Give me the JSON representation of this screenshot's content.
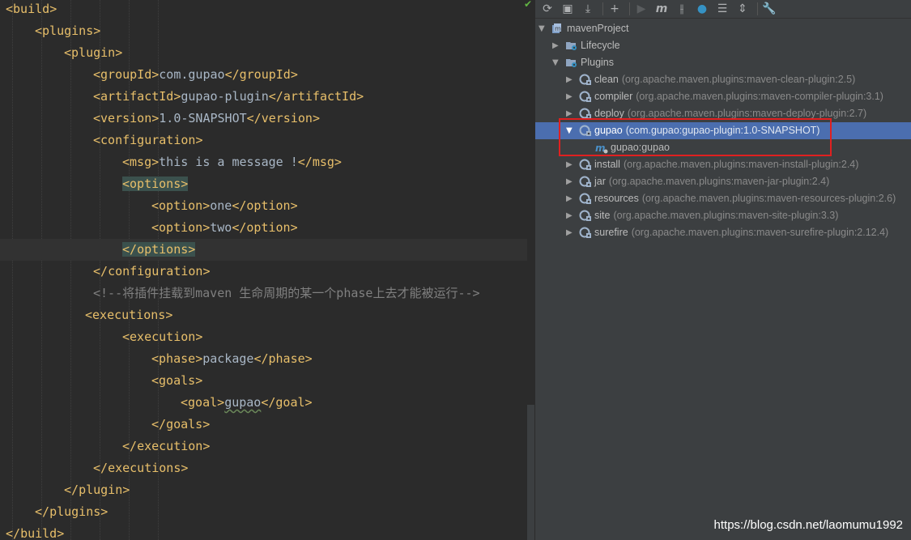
{
  "editor": {
    "lines": [
      {
        "indent": 0,
        "parts": [
          {
            "c": "lt",
            "t": "<"
          },
          {
            "c": "tg",
            "t": "build"
          },
          {
            "c": "lt",
            "t": ">"
          }
        ]
      },
      {
        "indent": 1,
        "parts": [
          {
            "c": "lt",
            "t": "<"
          },
          {
            "c": "tg",
            "t": "plugins"
          },
          {
            "c": "lt",
            "t": ">"
          }
        ]
      },
      {
        "indent": 2,
        "parts": [
          {
            "c": "lt",
            "t": "<"
          },
          {
            "c": "tg",
            "t": "plugin"
          },
          {
            "c": "lt",
            "t": ">"
          }
        ]
      },
      {
        "indent": 3,
        "parts": [
          {
            "c": "lt",
            "t": "<"
          },
          {
            "c": "tg",
            "t": "groupId"
          },
          {
            "c": "lt",
            "t": ">"
          },
          {
            "c": "tx",
            "t": "com.gupao"
          },
          {
            "c": "lt",
            "t": "</"
          },
          {
            "c": "tg",
            "t": "groupId"
          },
          {
            "c": "lt",
            "t": ">"
          }
        ]
      },
      {
        "indent": 3,
        "parts": [
          {
            "c": "lt",
            "t": "<"
          },
          {
            "c": "tg",
            "t": "artifactId"
          },
          {
            "c": "lt",
            "t": ">"
          },
          {
            "c": "tx",
            "t": "gupao-plugin"
          },
          {
            "c": "lt",
            "t": "</"
          },
          {
            "c": "tg",
            "t": "artifactId"
          },
          {
            "c": "lt",
            "t": ">"
          }
        ]
      },
      {
        "indent": 3,
        "parts": [
          {
            "c": "lt",
            "t": "<"
          },
          {
            "c": "tg",
            "t": "version"
          },
          {
            "c": "lt",
            "t": ">"
          },
          {
            "c": "tx",
            "t": "1.0-SNAPSHOT"
          },
          {
            "c": "lt",
            "t": "</"
          },
          {
            "c": "tg",
            "t": "version"
          },
          {
            "c": "lt",
            "t": ">"
          }
        ]
      },
      {
        "indent": 3,
        "parts": [
          {
            "c": "lt",
            "t": "<"
          },
          {
            "c": "tg",
            "t": "configuration"
          },
          {
            "c": "lt",
            "t": ">"
          }
        ]
      },
      {
        "indent": 4,
        "parts": [
          {
            "c": "lt",
            "t": "<"
          },
          {
            "c": "tg",
            "t": "msg"
          },
          {
            "c": "lt",
            "t": ">"
          },
          {
            "c": "tx",
            "t": "this is a message !"
          },
          {
            "c": "lt",
            "t": "</"
          },
          {
            "c": "tg",
            "t": "msg"
          },
          {
            "c": "lt",
            "t": ">"
          }
        ]
      },
      {
        "indent": 4,
        "parts": [
          {
            "c": "lt hl",
            "t": "<"
          },
          {
            "c": "tg hl",
            "t": "options"
          },
          {
            "c": "lt hl",
            "t": ">"
          }
        ]
      },
      {
        "indent": 5,
        "parts": [
          {
            "c": "lt",
            "t": "<"
          },
          {
            "c": "tg",
            "t": "option"
          },
          {
            "c": "lt",
            "t": ">"
          },
          {
            "c": "tx",
            "t": "one"
          },
          {
            "c": "lt",
            "t": "</"
          },
          {
            "c": "tg",
            "t": "option"
          },
          {
            "c": "lt",
            "t": ">"
          }
        ]
      },
      {
        "indent": 5,
        "parts": [
          {
            "c": "lt",
            "t": "<"
          },
          {
            "c": "tg",
            "t": "option"
          },
          {
            "c": "lt",
            "t": ">"
          },
          {
            "c": "tx",
            "t": "two"
          },
          {
            "c": "lt",
            "t": "</"
          },
          {
            "c": "tg",
            "t": "option"
          },
          {
            "c": "lt",
            "t": ">"
          }
        ]
      },
      {
        "indent": 4,
        "current": true,
        "parts": [
          {
            "c": "lt hl",
            "t": "</"
          },
          {
            "c": "tg hl",
            "t": "options"
          },
          {
            "c": "lt hl",
            "t": ">"
          }
        ]
      },
      {
        "indent": 3,
        "parts": [
          {
            "c": "lt",
            "t": "</"
          },
          {
            "c": "tg",
            "t": "configuration"
          },
          {
            "c": "lt",
            "t": ">"
          }
        ]
      },
      {
        "indent": 3,
        "parts": [
          {
            "c": "cm",
            "t": "<!--将插件挂载到maven 生命周期的某一个phase上去才能被运行-->"
          }
        ]
      },
      {
        "indent": 3,
        "shift": -10,
        "parts": [
          {
            "c": "lt",
            "t": "<"
          },
          {
            "c": "tg",
            "t": "executions"
          },
          {
            "c": "lt",
            "t": ">"
          }
        ]
      },
      {
        "indent": 4,
        "parts": [
          {
            "c": "lt",
            "t": "<"
          },
          {
            "c": "tg",
            "t": "execution"
          },
          {
            "c": "lt",
            "t": ">"
          }
        ]
      },
      {
        "indent": 5,
        "parts": [
          {
            "c": "lt",
            "t": "<"
          },
          {
            "c": "tg",
            "t": "phase"
          },
          {
            "c": "lt",
            "t": ">"
          },
          {
            "c": "tx",
            "t": "package"
          },
          {
            "c": "lt",
            "t": "</"
          },
          {
            "c": "tg",
            "t": "phase"
          },
          {
            "c": "lt",
            "t": ">"
          }
        ]
      },
      {
        "indent": 5,
        "parts": [
          {
            "c": "lt",
            "t": "<"
          },
          {
            "c": "tg",
            "t": "goals"
          },
          {
            "c": "lt",
            "t": ">"
          }
        ]
      },
      {
        "indent": 6,
        "parts": [
          {
            "c": "lt",
            "t": "<"
          },
          {
            "c": "tg",
            "t": "goal"
          },
          {
            "c": "lt",
            "t": ">"
          },
          {
            "c": "tx squiggle",
            "t": "gupao"
          },
          {
            "c": "lt",
            "t": "</"
          },
          {
            "c": "tg",
            "t": "goal"
          },
          {
            "c": "lt",
            "t": ">"
          }
        ]
      },
      {
        "indent": 5,
        "parts": [
          {
            "c": "lt",
            "t": "</"
          },
          {
            "c": "tg",
            "t": "goals"
          },
          {
            "c": "lt",
            "t": ">"
          }
        ]
      },
      {
        "indent": 4,
        "parts": [
          {
            "c": "lt",
            "t": "</"
          },
          {
            "c": "tg",
            "t": "execution"
          },
          {
            "c": "lt",
            "t": ">"
          }
        ]
      },
      {
        "indent": 3,
        "parts": [
          {
            "c": "lt",
            "t": "</"
          },
          {
            "c": "tg",
            "t": "executions"
          },
          {
            "c": "lt",
            "t": ">"
          }
        ]
      },
      {
        "indent": 2,
        "parts": [
          {
            "c": "lt",
            "t": "</"
          },
          {
            "c": "tg",
            "t": "plugin"
          },
          {
            "c": "lt",
            "t": ">"
          }
        ]
      },
      {
        "indent": 1,
        "parts": [
          {
            "c": "lt",
            "t": "</"
          },
          {
            "c": "tg",
            "t": "plugins"
          },
          {
            "c": "lt",
            "t": ">"
          }
        ]
      },
      {
        "indent": 0,
        "parts": [
          {
            "c": "lt",
            "t": "</"
          },
          {
            "c": "tg",
            "t": "build"
          },
          {
            "c": "lt",
            "t": ">"
          }
        ]
      }
    ]
  },
  "maven_panel": {
    "toolbar": [
      {
        "name": "reimport-button",
        "glyph": "⟳"
      },
      {
        "name": "add-project-button",
        "glyph": "▣"
      },
      {
        "name": "download-button",
        "glyph": "⤓"
      },
      {
        "name": "sep"
      },
      {
        "name": "plus-button",
        "glyph": "+"
      },
      {
        "name": "sep"
      },
      {
        "name": "run-button",
        "glyph": "▶"
      },
      {
        "name": "execute-goal-button",
        "glyph": "m"
      },
      {
        "name": "toggle-offline-button",
        "glyph": "⫲"
      },
      {
        "name": "skip-tests-button",
        "glyph": "●"
      },
      {
        "name": "show-dependencies-button",
        "glyph": "☰"
      },
      {
        "name": "collapse-all-button",
        "glyph": "⇕"
      },
      {
        "name": "sep"
      },
      {
        "name": "settings-wrench-button",
        "glyph": "🔧"
      }
    ],
    "tree": [
      {
        "depth": 0,
        "arrow": "down",
        "icon": "maven-project-icon",
        "label": "mavenProject",
        "detail": ""
      },
      {
        "depth": 1,
        "arrow": "right",
        "icon": "folder-gear-icon",
        "label": "Lifecycle",
        "detail": ""
      },
      {
        "depth": 1,
        "arrow": "down",
        "icon": "folder-gear-icon",
        "label": "Plugins",
        "detail": ""
      },
      {
        "depth": 2,
        "arrow": "right",
        "icon": "plugin-icon",
        "label": "clean",
        "detail": "(org.apache.maven.plugins:maven-clean-plugin:2.5)"
      },
      {
        "depth": 2,
        "arrow": "right",
        "icon": "plugin-icon",
        "label": "compiler",
        "detail": "(org.apache.maven.plugins:maven-compiler-plugin:3.1)"
      },
      {
        "depth": 2,
        "arrow": "right",
        "icon": "plugin-icon",
        "label": "deploy",
        "detail": "(org.apache.maven.plugins:maven-deploy-plugin:2.7)"
      },
      {
        "depth": 2,
        "arrow": "down",
        "icon": "plugin-icon",
        "label": "gupao",
        "detail": "(com.gupao:gupao-plugin:1.0-SNAPSHOT)",
        "selected": true
      },
      {
        "depth": 3,
        "arrow": "",
        "icon": "maven-goal-icon",
        "label": "gupao:gupao",
        "detail": ""
      },
      {
        "depth": 2,
        "arrow": "right",
        "icon": "plugin-icon",
        "label": "install",
        "detail": "(org.apache.maven.plugins:maven-install-plugin:2.4)"
      },
      {
        "depth": 2,
        "arrow": "right",
        "icon": "plugin-icon",
        "label": "jar",
        "detail": "(org.apache.maven.plugins:maven-jar-plugin:2.4)"
      },
      {
        "depth": 2,
        "arrow": "right",
        "icon": "plugin-icon",
        "label": "resources",
        "detail": "(org.apache.maven.plugins:maven-resources-plugin:2.6)"
      },
      {
        "depth": 2,
        "arrow": "right",
        "icon": "plugin-icon",
        "label": "site",
        "detail": "(org.apache.maven.plugins:maven-site-plugin:3.3)"
      },
      {
        "depth": 2,
        "arrow": "right",
        "icon": "plugin-icon",
        "label": "surefire",
        "detail": "(org.apache.maven.plugins:maven-surefire-plugin:2.12.4)"
      }
    ]
  },
  "watermark": "https://blog.csdn.net/laomumu1992",
  "colors": {
    "accent_selection": "#4b6eaf",
    "highlight_box": "#e02020"
  }
}
